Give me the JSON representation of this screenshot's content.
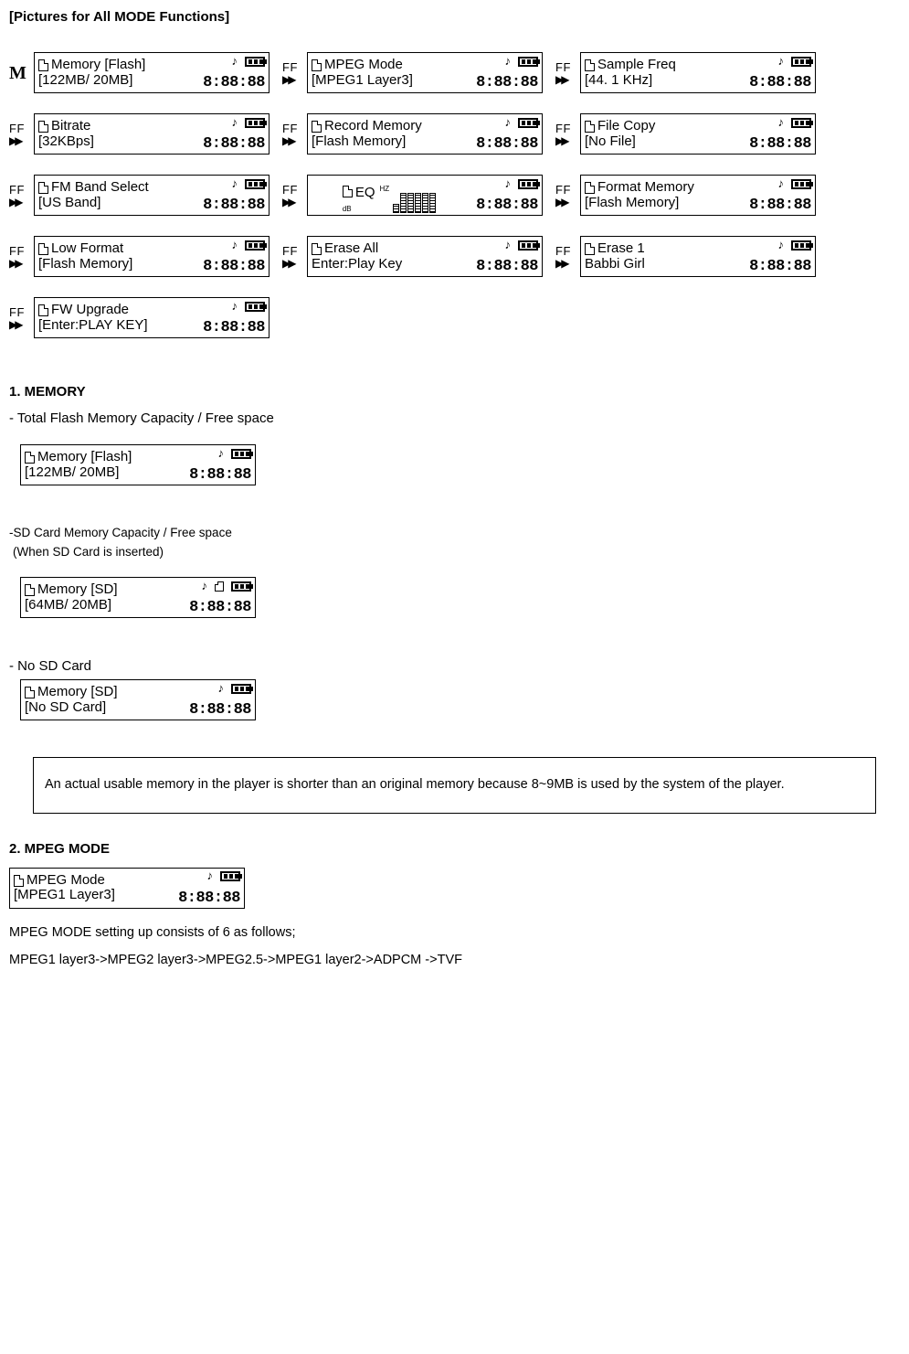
{
  "title": "[Pictures for All MODE Functions]",
  "prefix_m": "M",
  "prefix_ff": "FF",
  "digits": "8:88:88",
  "screens": [
    {
      "line1": "Memory [Flash]",
      "line2": "[122MB/ 20MB]",
      "prefix": "M"
    },
    {
      "line1": "MPEG Mode",
      "line2": "[MPEG1 Layer3]",
      "prefix": "FF"
    },
    {
      "line1": "Sample Freq",
      "line2": "[44. 1 KHz]",
      "prefix": "FF"
    },
    {
      "line1": "Bitrate",
      "line2": "[32KBps]",
      "prefix": "FF"
    },
    {
      "line1": "Record Memory",
      "line2": "[Flash Memory]",
      "prefix": "FF"
    },
    {
      "line1": "File Copy",
      "line2": "[No File]",
      "prefix": "FF"
    },
    {
      "line1": "FM Band Select",
      "line2": "[US Band]",
      "prefix": "FF"
    },
    {
      "eq": true,
      "line1": "EQ",
      "prefix": "FF"
    },
    {
      "line1": "Format Memory",
      "line2": "[Flash Memory]",
      "prefix": "FF"
    },
    {
      "line1": "Low Format",
      "line2": "[Flash Memory]",
      "prefix": "FF"
    },
    {
      "line1": "Erase All",
      "line2": "Enter:Play Key",
      "prefix": "FF"
    },
    {
      "line1": "Erase 1",
      "line2": "Babbi Girl",
      "prefix": "FF"
    },
    {
      "line1": "FW Upgrade",
      "line2": "[Enter:PLAY KEY]",
      "prefix": "FF"
    }
  ],
  "section1": {
    "heading": "1. MEMORY",
    "line_a": "- Total Flash Memory Capacity / Free space",
    "lcd_a": {
      "line1": "Memory [Flash]",
      "line2": "[122MB/ 20MB]"
    },
    "line_b": "-SD Card Memory Capacity / Free space",
    "line_b2": "(When SD Card is inserted)",
    "lcd_b": {
      "line1": "Memory [SD]",
      "line2": "[64MB/ 20MB]"
    },
    "line_c": "- No SD Card",
    "lcd_c": {
      "line1": "Memory [SD]",
      "line2": "[No SD Card]"
    }
  },
  "note": "An actual usable memory in the player is shorter than an original memory because 8~9MB is used by the system of the player.",
  "section2": {
    "heading": "2. MPEG MODE",
    "lcd": {
      "line1": "MPEG Mode",
      "line2": "[MPEG1 Layer3]"
    },
    "text1": "MPEG MODE setting up consists of 6 as follows;",
    "text2": "MPEG1 layer3->MPEG2 layer3->MPEG2.5->MPEG1 layer2->ADPCM ->TVF"
  }
}
